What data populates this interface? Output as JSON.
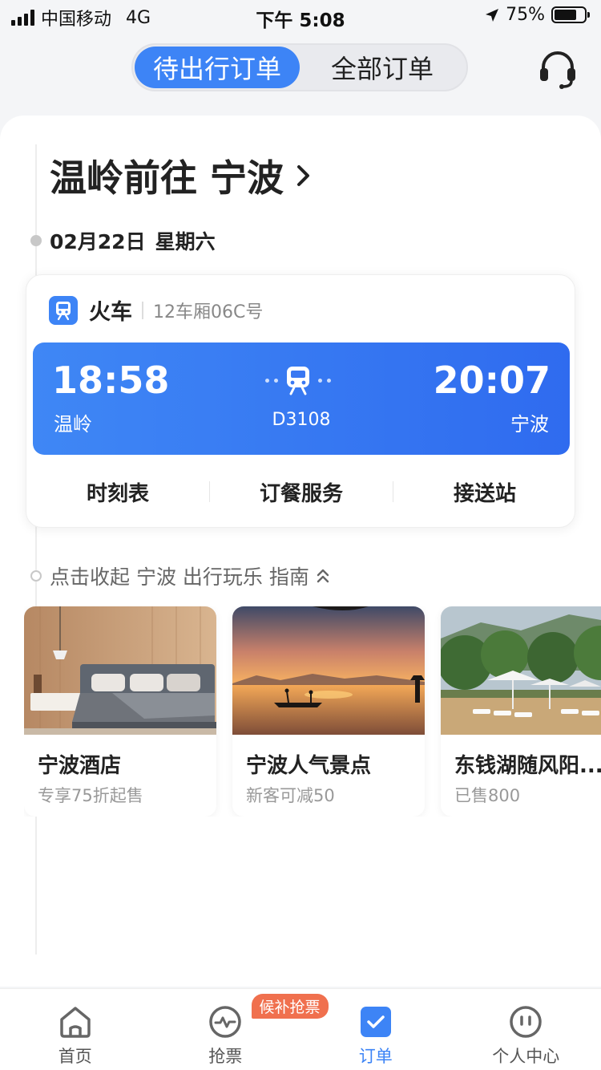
{
  "status_bar": {
    "carrier": "中国移动",
    "network": "4G",
    "time": "下午 5:08",
    "battery": "75%",
    "battery_level": 0.75
  },
  "top_tabs": [
    {
      "label": "待出行订单",
      "active": true
    },
    {
      "label": "全部订单",
      "active": false
    }
  ],
  "trip": {
    "title": "温岭前往 宁波",
    "date": "02月22日",
    "weekday": "星期六"
  },
  "ticket": {
    "type": "火车",
    "seat": "12车厢06C号",
    "depart_time": "18:58",
    "depart_station": "温岭",
    "arrive_time": "20:07",
    "arrive_station": "宁波",
    "train_number": "D3108",
    "actions": [
      "时刻表",
      "订餐服务",
      "接送站"
    ]
  },
  "guide": {
    "toggle_text": "点击收起 宁波 出行玩乐 指南",
    "cards": [
      {
        "title": "宁波酒店",
        "subtitle": "专享75折起售"
      },
      {
        "title": "宁波人气景点",
        "subtitle": "新客可减50"
      },
      {
        "title": "东钱湖随风阳...",
        "subtitle": "已售800"
      }
    ]
  },
  "tabbar": {
    "items": [
      {
        "label": "首页",
        "icon": "home-icon",
        "active": false
      },
      {
        "label": "抢票",
        "icon": "pulse-icon",
        "active": false
      },
      {
        "label": "订单",
        "icon": "order-check-icon",
        "active": true
      },
      {
        "label": "个人中心",
        "icon": "profile-icon",
        "active": false
      }
    ],
    "badge": "候补抢票"
  },
  "colors": {
    "accent": "#3d84f6",
    "badge": "#f0704e"
  }
}
